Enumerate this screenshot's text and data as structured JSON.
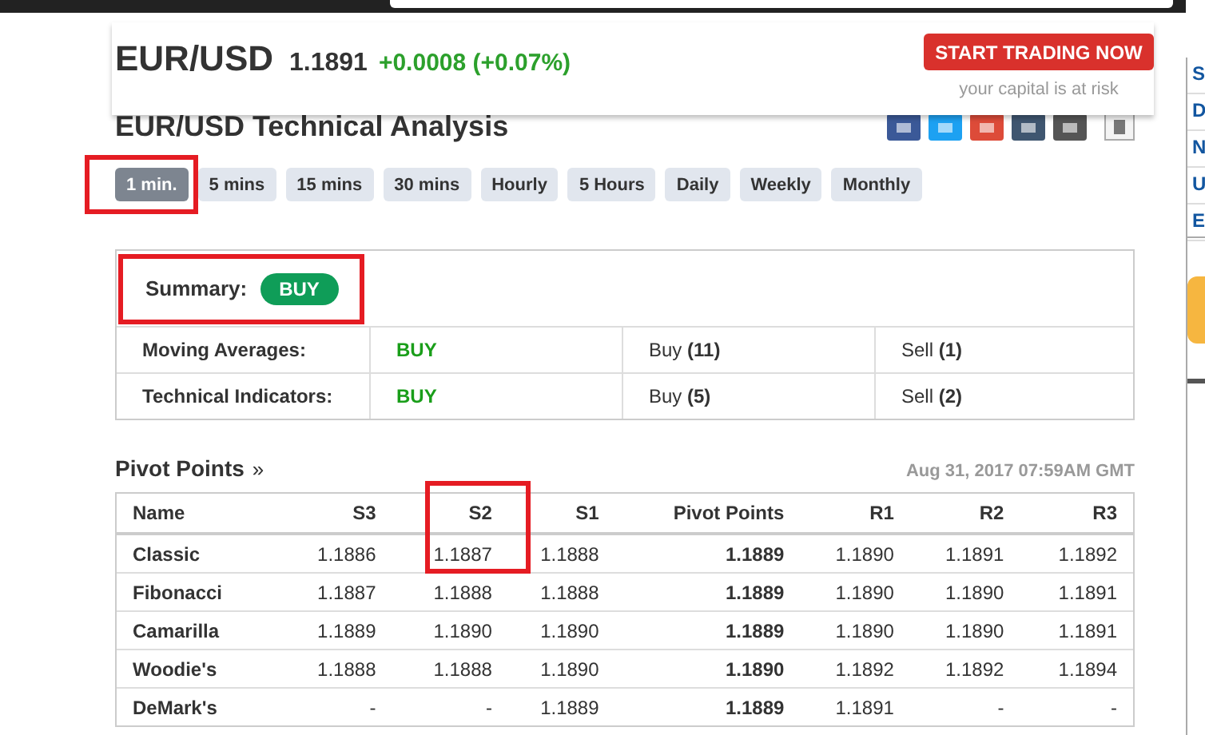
{
  "quote": {
    "symbol": "EUR/USD",
    "price": "1.1891",
    "change": "+0.0008 (+0.07%)",
    "cta": "START TRADING NOW",
    "risk_note": "your capital is at risk"
  },
  "title": "EUR/USD Technical Analysis",
  "tabs": [
    {
      "label": "1 min.",
      "selected": true,
      "highlighted": true
    },
    {
      "label": "5 mins",
      "selected": false,
      "highlighted": false
    },
    {
      "label": "15 mins",
      "selected": false,
      "highlighted": false
    },
    {
      "label": "30 mins",
      "selected": false,
      "highlighted": false
    },
    {
      "label": "Hourly",
      "selected": false,
      "highlighted": false
    },
    {
      "label": "5 Hours",
      "selected": false,
      "highlighted": false
    },
    {
      "label": "Daily",
      "selected": false,
      "highlighted": false
    },
    {
      "label": "Weekly",
      "selected": false,
      "highlighted": false
    },
    {
      "label": "Monthly",
      "selected": false,
      "highlighted": false
    }
  ],
  "summary": {
    "label": "Summary:",
    "signal": "BUY",
    "highlighted": true,
    "rows": [
      {
        "name": "Moving Averages:",
        "signal": "BUY",
        "buy": "Buy **(11)**",
        "sell": "Sell **(1)**"
      },
      {
        "name": "Technical Indicators:",
        "signal": "BUY",
        "buy": "Buy **(5)**",
        "sell": "Sell **(2)**"
      }
    ]
  },
  "pivot_points": {
    "title": "Pivot Points",
    "link_mark": "»",
    "timestamp": "Aug 31, 2017 07:59AM GMT",
    "columns": [
      {
        "label": "Name",
        "kind": "name",
        "highlighted": false
      },
      {
        "label": "S3",
        "kind": "level",
        "highlighted": false
      },
      {
        "label": "S2",
        "kind": "level",
        "highlighted": true
      },
      {
        "label": "S1",
        "kind": "level",
        "highlighted": false
      },
      {
        "label": "Pivot Points",
        "kind": "pivot",
        "highlighted": false
      },
      {
        "label": "R1",
        "kind": "level",
        "highlighted": false
      },
      {
        "label": "R2",
        "kind": "level",
        "highlighted": false
      },
      {
        "label": "R3",
        "kind": "level",
        "highlighted": false
      }
    ],
    "rows": [
      [
        "Classic",
        "1.1886",
        "1.1887",
        "1.1888",
        "1.1889",
        "1.1890",
        "1.1891",
        "1.1892"
      ],
      [
        "Fibonacci",
        "1.1887",
        "1.1888",
        "1.1888",
        "1.1889",
        "1.1890",
        "1.1890",
        "1.1891"
      ],
      [
        "Camarilla",
        "1.1889",
        "1.1890",
        "1.1890",
        "1.1889",
        "1.1890",
        "1.1890",
        "1.1891"
      ],
      [
        "Woodie's",
        "1.1888",
        "1.1888",
        "1.1890",
        "1.1890",
        "1.1892",
        "1.1892",
        "1.1894"
      ],
      [
        "DeMark's",
        "-",
        "-",
        "1.1889",
        "1.1889",
        "1.1891",
        "-",
        "-"
      ]
    ]
  },
  "right_sidebar": {
    "items": [
      "S",
      "D",
      "N",
      "U",
      "E"
    ]
  }
}
